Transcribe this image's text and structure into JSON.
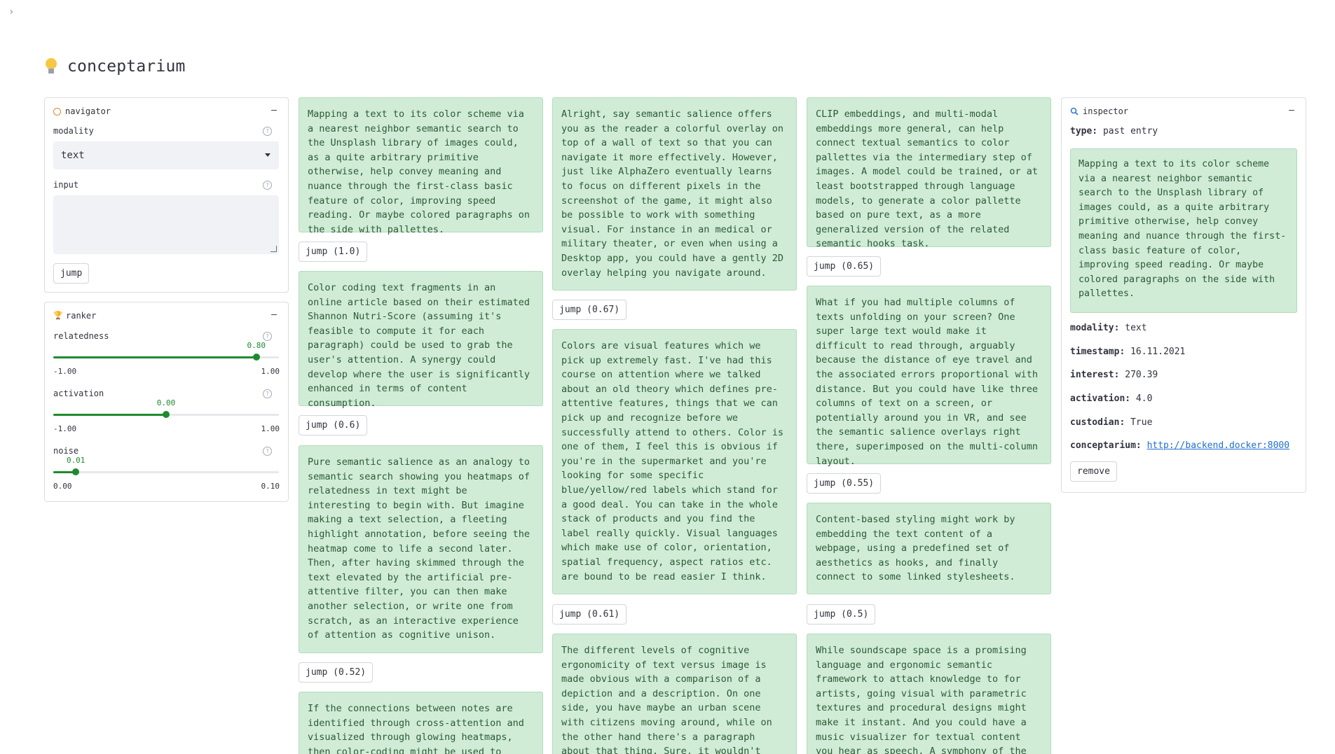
{
  "app_title": "conceptarium",
  "navigator": {
    "title": "navigator",
    "collapse": "–",
    "modality_label": "modality",
    "modality_value": "text",
    "input_label": "input",
    "input_value": "",
    "jump_label": "jump"
  },
  "ranker": {
    "title": "ranker",
    "collapse": "–",
    "relatedness": {
      "label": "relatedness",
      "value": "0.80",
      "min": "-1.00",
      "max": "1.00",
      "fraction": 0.9
    },
    "activation": {
      "label": "activation",
      "value": "0.00",
      "min": "-1.00",
      "max": "1.00",
      "fraction": 0.5
    },
    "noise": {
      "label": "noise",
      "value": "0.01",
      "min": "0.00",
      "max": "0.10",
      "fraction": 0.1
    }
  },
  "results": [
    {
      "text": "Mapping a text to its color scheme via a nearest neighbor semantic search to the Unsplash library of images could, as a quite arbitrary primitive otherwise, help convey meaning and nuance through the first-class basic feature of color, improving speed reading. Or maybe colored paragraphs on the side with pallettes.",
      "jump": "jump (1.0)"
    },
    {
      "text": "Color coding text fragments in an online article based on their estimated Shannon Nutri-Score (assuming it's feasible to compute it for each paragraph) could be used to grab the user's attention. A synergy could develop where the user is significantly enhanced in terms of content consumption.",
      "jump": "jump (0.6)"
    },
    {
      "text": "Pure semantic salience as an analogy to semantic search showing you heatmaps of relatedness in text might be interesting to begin with. But imagine making a text selection, a fleeting highlight annotation, before seeing the heatmap come to life a second later. Then, after having skimmed through the text elevated by the artificial pre-attentive filter, you can then make another selection, or write one from scratch, as an interactive experience of attention as cognitive unison.",
      "jump": "jump (0.52)"
    },
    {
      "text": "If the connections between notes are identified through cross-attention and visualized through glowing heatmaps, then color-coding might be used to understand"
    },
    {
      "text": "Alright, say semantic salience offers you as the reader a colorful overlay on top of a wall of text so that you can navigate it more effectively. However, just like AlphaZero eventually learns to focus on different pixels in the screenshot of the game, it might also be possible to work with something visual. For instance in an medical or military theater, or even when using a Desktop app, you could have a gently 2D overlay helping you navigate around.",
      "jump": "jump (0.67)"
    },
    {
      "text": "Colors are visual features which we pick up extremely fast. I've had this course on attention where we talked about an old theory which defines pre-attentive features, things that we can pick up and recognize before we successfully attend to others. Color is one of them, I feel this is obvious if you're in the supermarket and you're looking for some specific blue/yellow/red labels which stand for a good deal. You can take in the whole stack of products and you find the label really quickly. Visual languages which make use of color, orientation, spatial frequency, aspect ratios etc. are bound to be read easier I think.",
      "jump": "jump (0.61)"
    },
    {
      "text": "The different levels of cognitive ergonomicity of text versus image is made obvious with a comparison of a depiction and a description. On one side, you have maybe an urban scene with citizens moving around, while on the other hand there's a paragraph about that thing. Sure, it wouldn't work well with highly intangible"
    },
    {
      "text": "CLIP embeddings, and multi-modal embeddings more general, can help connect textual semantics to color pallettes via the intermediary step of images. A model could be trained, or at least bootstrapped through language models, to generate a color pallette based on pure text, as a more generalized version of the related semantic hooks task.",
      "jump": "jump (0.65)"
    },
    {
      "text": "What if you had multiple columns of texts unfolding on your screen? One super large text would make it difficult to read through, arguably because the distance of eye travel and the associated errors proportional with distance. But you could have like three columns of text on a screen, or potentially around you in VR, and see the semantic salience overlays right there, superimposed on the multi-column layout.",
      "jump": "jump (0.55)"
    },
    {
      "text": "Content-based styling might work by embedding the text content of a webpage, using a predefined set of aesthetics as hooks, and finally connect to some linked stylesheets.",
      "jump": "jump (0.5)"
    },
    {
      "text": "While soundscape space is a promising language and ergonomic semantic framework to attach knowledge to for artists, going visual with parametric textures and procedural designs might make it instant. And you could have a music visualizer for textual content you hear as speech. A symphony of the senses."
    }
  ],
  "inspector": {
    "title": "inspector",
    "collapse": "–",
    "type_key": "type:",
    "type_value": "past entry",
    "content": "Mapping a text to its color scheme via a nearest neighbor semantic search to the Unsplash library of images could, as a quite arbitrary primitive otherwise, help convey meaning and nuance through the first-class basic feature of color, improving speed reading. Or maybe colored paragraphs on the side with pallettes.",
    "modality_key": "modality:",
    "modality_value": "text",
    "timestamp_key": "timestamp:",
    "timestamp_value": "16.11.2021",
    "interest_key": "interest:",
    "interest_value": "270.39",
    "activation_key": "activation:",
    "activation_value": "4.0",
    "custodian_key": "custodian:",
    "custodian_value": "True",
    "conceptarium_key": "conceptarium:",
    "conceptarium_value": "http://backend.docker:8000",
    "remove_label": "remove"
  },
  "colors": {
    "card_bg": "#d0ecd6",
    "card_text": "#2c5a36",
    "accent": "#1f8a2e",
    "link": "#1f6fd1"
  }
}
